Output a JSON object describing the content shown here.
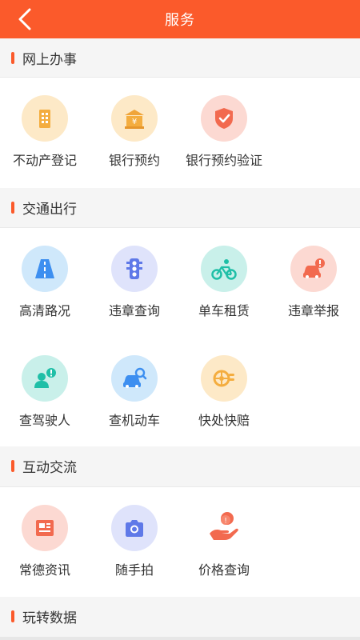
{
  "header": {
    "title": "服务"
  },
  "sections": [
    {
      "title": "网上办事",
      "items": [
        {
          "label": "不动产登记",
          "icon": "building-icon"
        },
        {
          "label": "银行预约",
          "icon": "bank-icon"
        },
        {
          "label": "银行预约验证",
          "icon": "shield-check-icon"
        }
      ]
    },
    {
      "title": "交通出行",
      "items": [
        {
          "label": "高清路况",
          "icon": "road-icon"
        },
        {
          "label": "违章查询",
          "icon": "traffic-light-icon"
        },
        {
          "label": "单车租赁",
          "icon": "bicycle-icon"
        },
        {
          "label": "违章举报",
          "icon": "car-alert-icon"
        },
        {
          "label": "查驾驶人",
          "icon": "driver-alert-icon"
        },
        {
          "label": "查机动车",
          "icon": "car-search-icon"
        },
        {
          "label": "快处快赔",
          "icon": "wheel-icon"
        }
      ]
    },
    {
      "title": "互动交流",
      "items": [
        {
          "label": "常德资讯",
          "icon": "news-icon"
        },
        {
          "label": "随手拍",
          "icon": "camera-icon"
        },
        {
          "label": "价格查询",
          "icon": "hand-price-icon"
        }
      ]
    },
    {
      "title": "玩转数据",
      "items": []
    }
  ],
  "colors": {
    "header": "#fb5a2b",
    "accent": "#fb5a2b"
  }
}
